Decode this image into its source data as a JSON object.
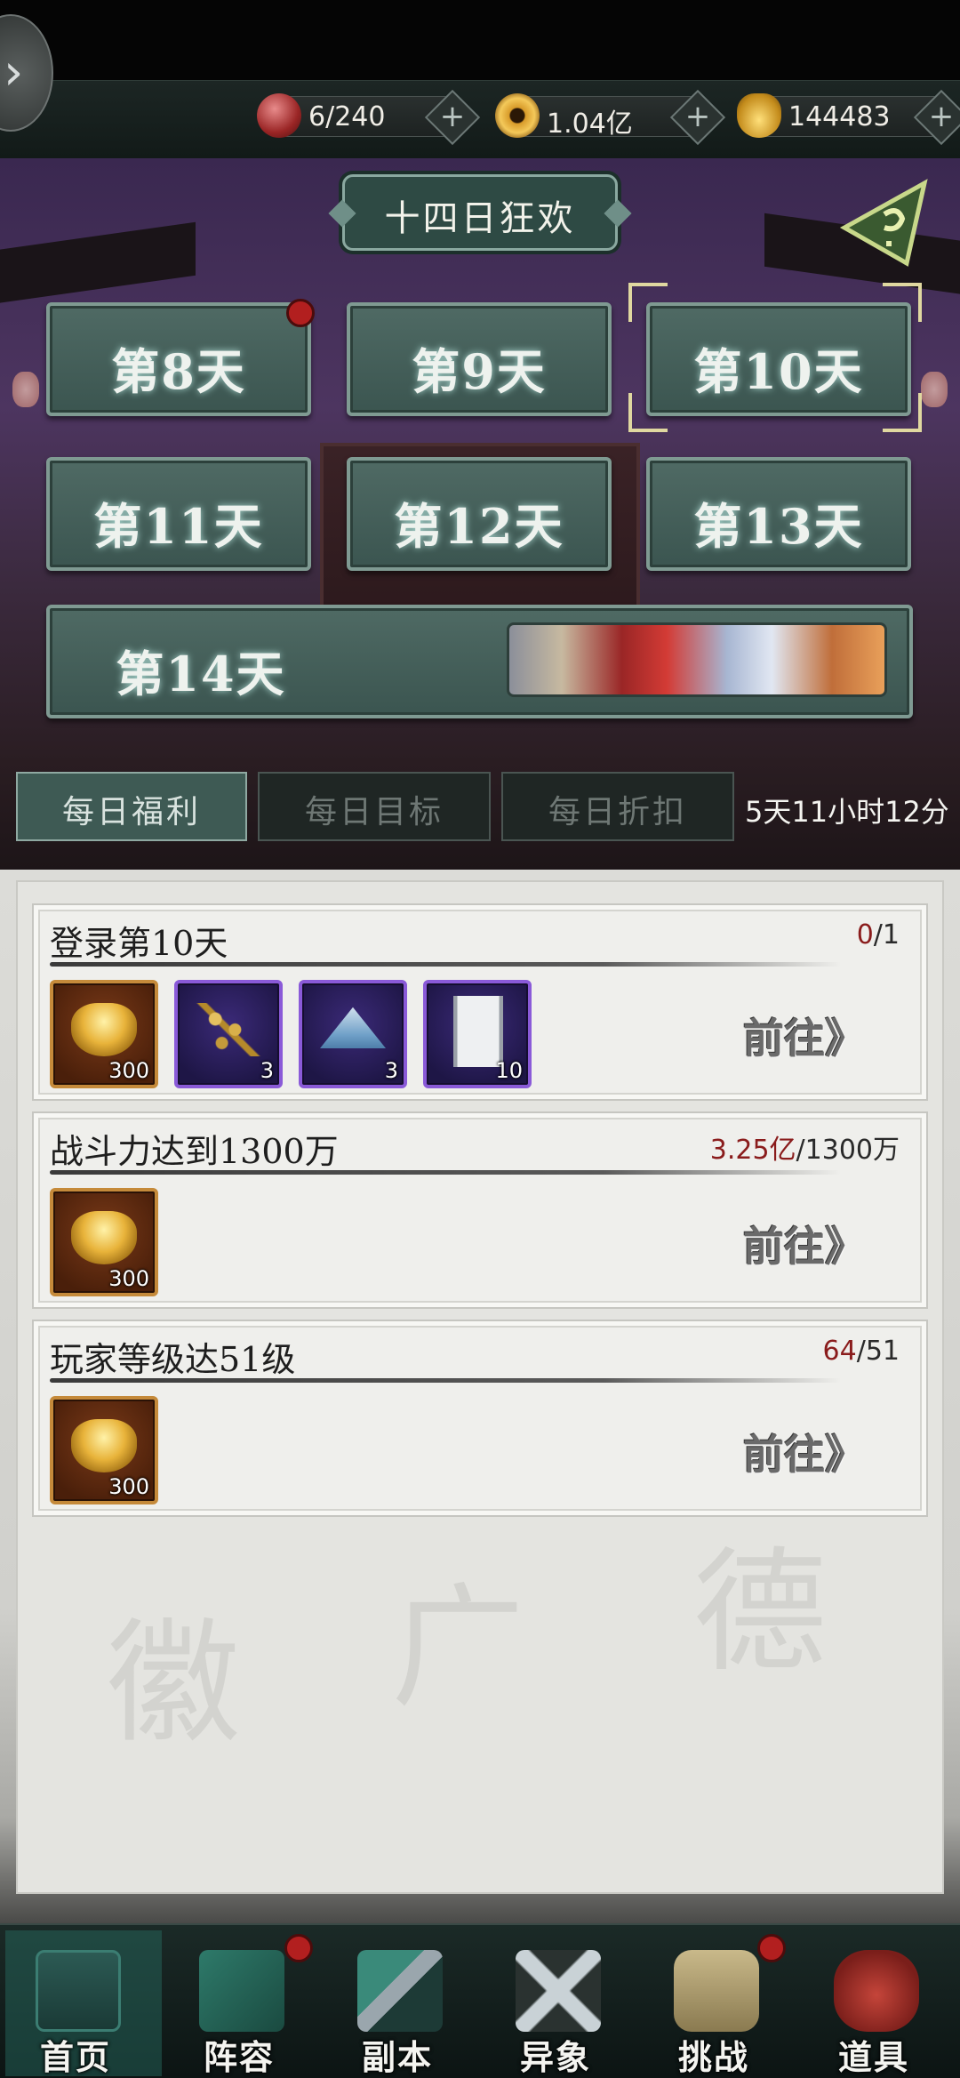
{
  "topbar": {
    "back_icon": "chevron-right-icon",
    "resources": [
      {
        "id": "stamina",
        "icon": "red-orb-icon",
        "value": "6/240"
      },
      {
        "id": "coins",
        "icon": "gold-coin-icon",
        "value": "1.04亿"
      },
      {
        "id": "ingot",
        "icon": "gold-ingot-icon",
        "value": "144483"
      }
    ],
    "plus_symbol": "+"
  },
  "event": {
    "title": "十四日狂欢",
    "days": [
      {
        "label": "第8天",
        "has_notification": true,
        "selected": false
      },
      {
        "label": "第9天",
        "has_notification": false,
        "selected": false
      },
      {
        "label": "第10天",
        "has_notification": false,
        "selected": true
      },
      {
        "label": "第11天",
        "has_notification": false,
        "selected": false
      },
      {
        "label": "第12天",
        "has_notification": false,
        "selected": false
      },
      {
        "label": "第13天",
        "has_notification": false,
        "selected": false
      },
      {
        "label": "第14天",
        "has_notification": false,
        "selected": false
      }
    ],
    "tabs": [
      {
        "label": "每日福利",
        "active": true
      },
      {
        "label": "每日目标",
        "active": false
      },
      {
        "label": "每日折扣",
        "active": false
      }
    ],
    "countdown": "5天11小时12分"
  },
  "tasks": [
    {
      "title": "登录第10天",
      "progress_current": "0",
      "progress_total": "/1",
      "goto_label": "前往》",
      "rewards": [
        {
          "icon": "gold-ingot-icon",
          "qty": "300",
          "rarity": "orange"
        },
        {
          "icon": "herb-icon",
          "qty": "3",
          "rarity": "purple"
        },
        {
          "icon": "powder-icon",
          "qty": "3",
          "rarity": "purple"
        },
        {
          "icon": "scroll-icon",
          "qty": "10",
          "rarity": "purple"
        }
      ]
    },
    {
      "title": "战斗力达到1300万",
      "progress_current": "3.25亿",
      "progress_total": "/1300万",
      "goto_label": "前往》",
      "rewards": [
        {
          "icon": "gold-ingot-icon",
          "qty": "300",
          "rarity": "orange"
        }
      ]
    },
    {
      "title": "玩家等级达51级",
      "progress_current": "64",
      "progress_total": "/51",
      "goto_label": "前往》",
      "rewards": [
        {
          "icon": "gold-ingot-icon",
          "qty": "300",
          "rarity": "orange"
        }
      ]
    }
  ],
  "bottom_nav": [
    {
      "label": "首页",
      "icon": "home-pavilion-icon",
      "has_notification": false
    },
    {
      "label": "阵容",
      "icon": "lineup-book-icon",
      "has_notification": true
    },
    {
      "label": "副本",
      "icon": "sword-icon",
      "has_notification": false
    },
    {
      "label": "异象",
      "icon": "crossed-swords-icon",
      "has_notification": false
    },
    {
      "label": "挑战",
      "icon": "challenge-scroll-icon",
      "has_notification": true
    },
    {
      "label": "道具",
      "icon": "item-bag-icon",
      "has_notification": false
    }
  ],
  "colors": {
    "progress_current": "#8a1c1c",
    "day_button": "#4f6a64",
    "notification": "#b21f1f",
    "rarity_orange": "#c58a3a",
    "rarity_purple": "#8a5ad8"
  }
}
